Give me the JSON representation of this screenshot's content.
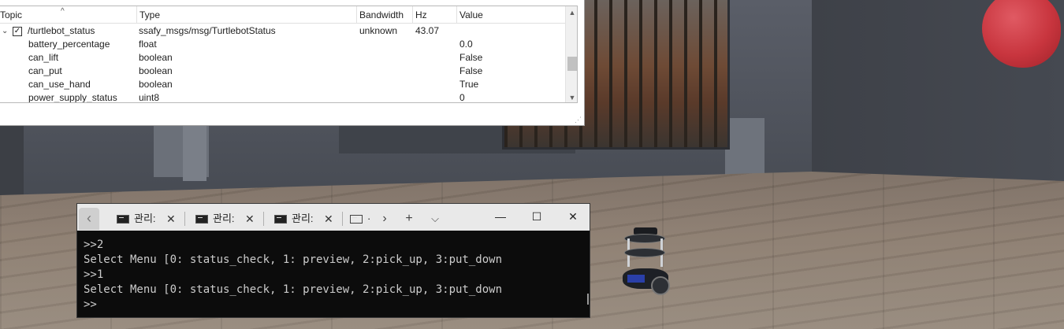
{
  "topic_monitor": {
    "columns": [
      "Topic",
      "Type",
      "Bandwidth",
      "Hz",
      "Value"
    ],
    "topic_row": {
      "topic": "/turtlebot_status",
      "type": "ssafy_msgs/msg/TurtlebotStatus",
      "bandwidth": "unknown",
      "hz": "43.07",
      "value": "",
      "checked": true
    },
    "fields": [
      {
        "topic": "battery_percentage",
        "type": "float",
        "value": "0.0"
      },
      {
        "topic": "can_lift",
        "type": "boolean",
        "value": "False"
      },
      {
        "topic": "can_put",
        "type": "boolean",
        "value": "False"
      },
      {
        "topic": "can_use_hand",
        "type": "boolean",
        "value": "True"
      },
      {
        "topic": "power_supply_status",
        "type": "uint8",
        "value": "0"
      }
    ]
  },
  "terminal": {
    "tabs": [
      {
        "label": "관리:",
        "icon": "console-icon"
      },
      {
        "label": "관리:",
        "icon": "console-icon"
      },
      {
        "label": "관리:",
        "icon": "console-icon"
      },
      {
        "label": "·",
        "icon": "console-icon"
      }
    ],
    "close_glyph": "✕",
    "new_tab_glyph": "+",
    "dropdown_glyph": "⌵",
    "minimize_glyph": "—",
    "maximize_glyph": "☐",
    "window_close_glyph": "✕",
    "lines": [
      ">>2",
      "Select Menu [0: status_check, 1: preview, 2:pick_up, 3:put_down",
      ">>1",
      "Select Menu [0: status_check, 1: preview, 2:pick_up, 3:put_down",
      ">>"
    ]
  },
  "colors": {
    "terminal_bg": "#0c0c0c",
    "terminal_text": "#cccccc",
    "balloon": "#c8353e"
  }
}
